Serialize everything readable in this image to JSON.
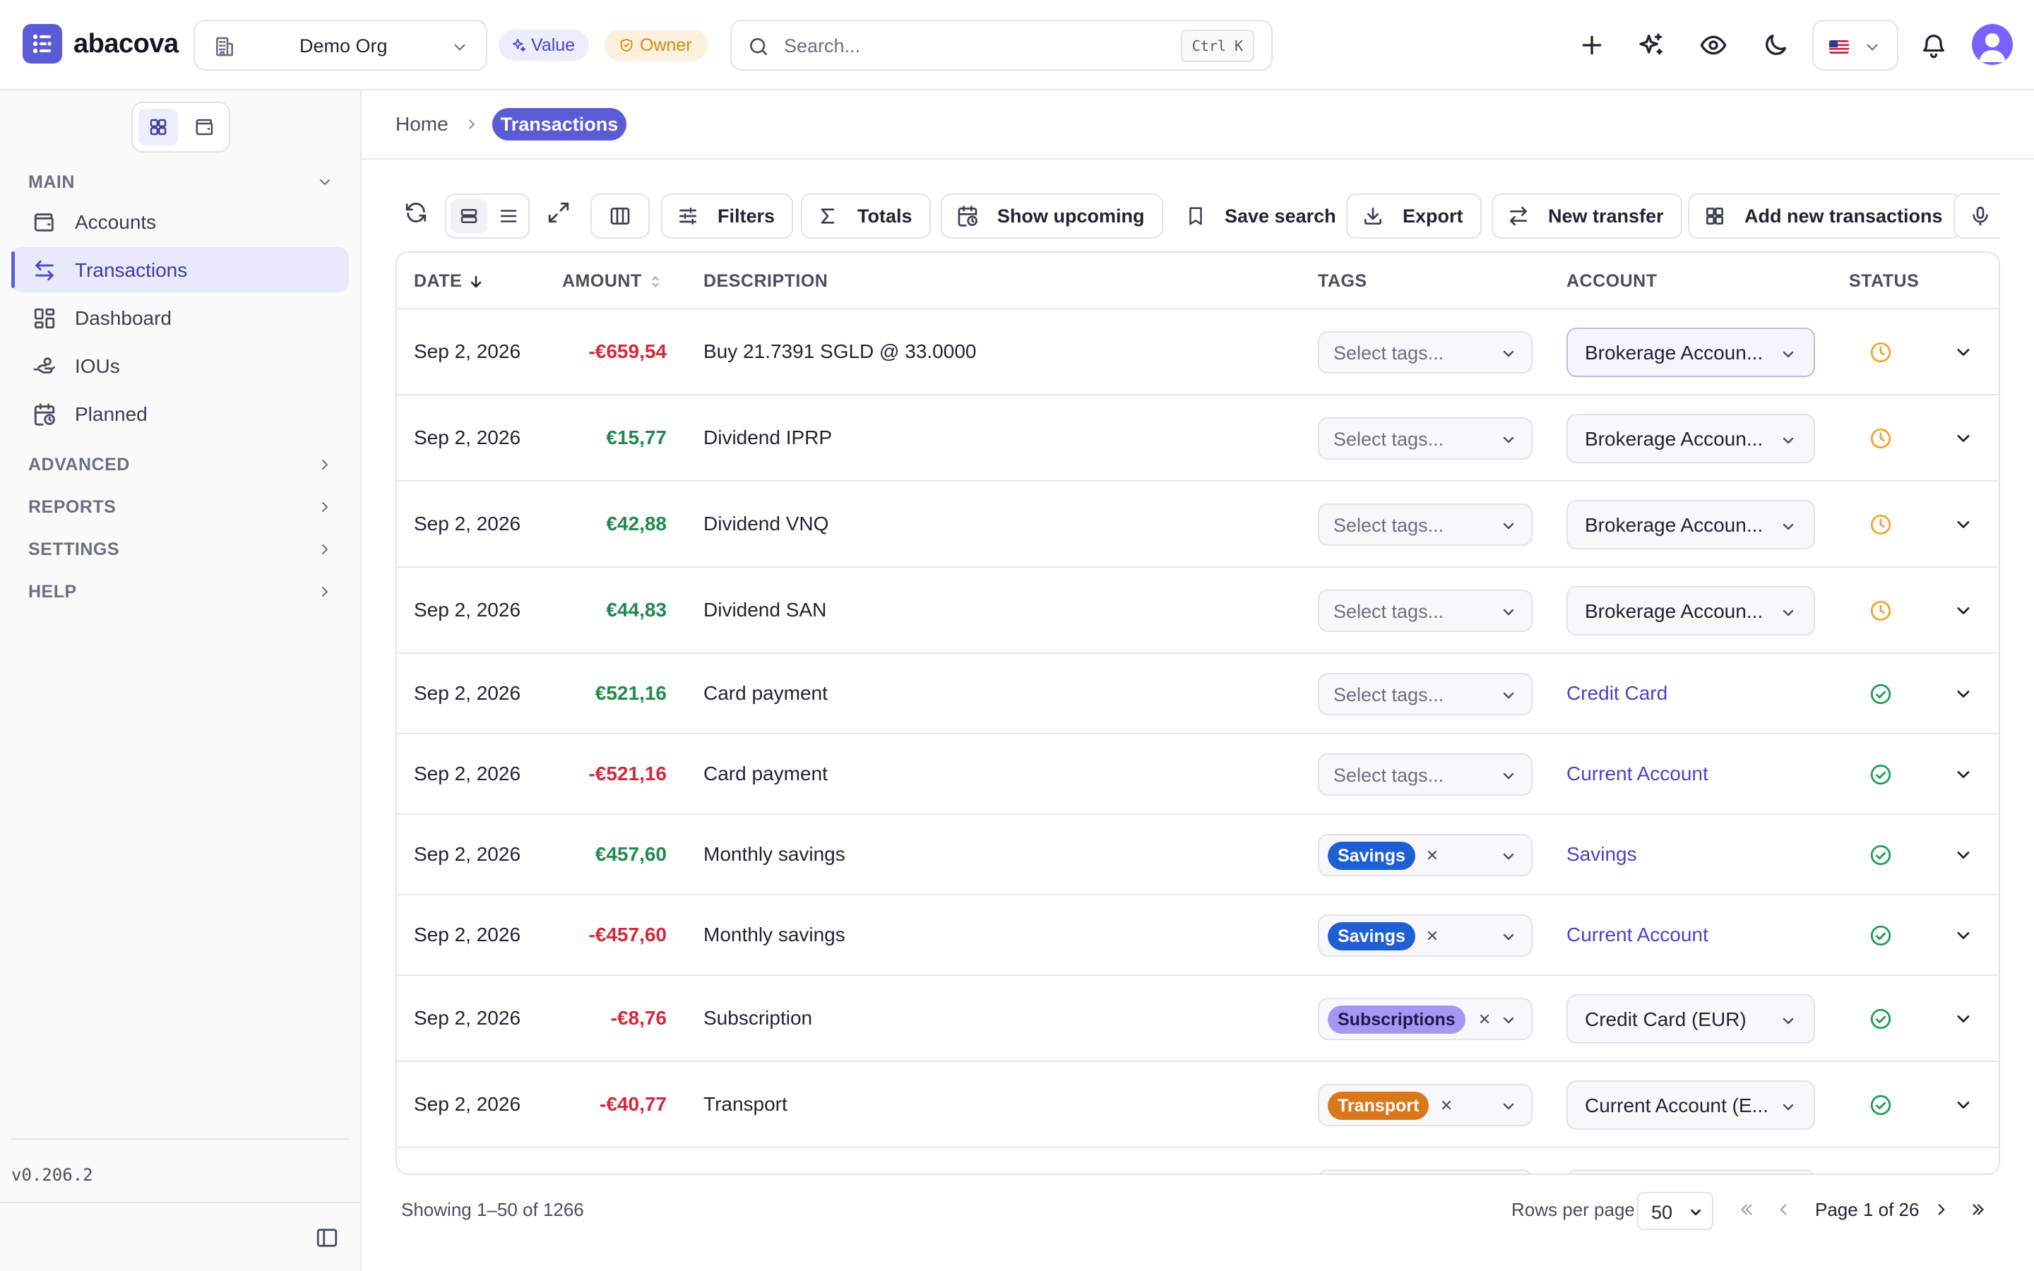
{
  "app": {
    "name": "abacova",
    "org": "Demo Org",
    "role_value": "Value",
    "role_owner": "Owner",
    "search_placeholder": "Search...",
    "search_shortcut": "Ctrl K",
    "version": "v0.206.2"
  },
  "colors": {
    "brand": "#5b5bd6",
    "negative": "#d12a3b",
    "positive": "#1f8a4c",
    "pending": "#f2a531",
    "confirmed": "#1f9e5a",
    "tag_savings": "#1f5fd6",
    "tag_subscriptions": "#a896f5",
    "tag_transport": "#d9781a"
  },
  "topbar_icons": [
    "plus-icon",
    "sparkles-icon",
    "eye-icon",
    "moon-icon",
    "us-flag-icon",
    "bell-icon",
    "avatar"
  ],
  "sidebar": {
    "main_label": "MAIN",
    "items": [
      {
        "label": "Accounts",
        "icon": "wallet-icon"
      },
      {
        "label": "Transactions",
        "icon": "transfer-arrows-icon"
      },
      {
        "label": "Dashboard",
        "icon": "dashboard-grid-icon"
      },
      {
        "label": "IOUs",
        "icon": "hand-coins-icon"
      },
      {
        "label": "Planned",
        "icon": "calendar-clock-icon"
      }
    ],
    "sections": [
      "ADVANCED",
      "REPORTS",
      "SETTINGS",
      "HELP"
    ]
  },
  "breadcrumb": {
    "home": "Home",
    "current": "Transactions"
  },
  "toolbar": {
    "filters": "Filters",
    "totals": "Totals",
    "show_upcoming": "Show upcoming",
    "save_search": "Save search",
    "export": "Export",
    "new_transfer": "New transfer",
    "add_new": "Add new transactions"
  },
  "table": {
    "headers": {
      "date": "DATE",
      "amount": "AMOUNT",
      "description": "DESCRIPTION",
      "tags": "TAGS",
      "account": "ACCOUNT",
      "status": "STATUS"
    },
    "tag_placeholder": "Select tags...",
    "rows": [
      {
        "date": "Sep 2, 2026",
        "amount": "-€659,54",
        "sign": "neg",
        "description": "Buy 21.7391 SGLD @ 33.0000",
        "tag": "",
        "account": "Brokerage Accoun...",
        "account_kind": "select",
        "status": "pending"
      },
      {
        "date": "Sep 2, 2026",
        "amount": "€15,77",
        "sign": "pos",
        "description": "Dividend IPRP",
        "tag": "",
        "account": "Brokerage Accoun...",
        "account_kind": "select",
        "status": "pending"
      },
      {
        "date": "Sep 2, 2026",
        "amount": "€42,88",
        "sign": "pos",
        "description": "Dividend VNQ",
        "tag": "",
        "account": "Brokerage Accoun...",
        "account_kind": "select",
        "status": "pending"
      },
      {
        "date": "Sep 2, 2026",
        "amount": "€44,83",
        "sign": "pos",
        "description": "Dividend SAN",
        "tag": "",
        "account": "Brokerage Accoun...",
        "account_kind": "select",
        "status": "pending"
      },
      {
        "date": "Sep 2, 2026",
        "amount": "€521,16",
        "sign": "pos",
        "description": "Card payment",
        "tag": "",
        "account": "Credit Card",
        "account_kind": "link",
        "status": "confirmed"
      },
      {
        "date": "Sep 2, 2026",
        "amount": "-€521,16",
        "sign": "neg",
        "description": "Card payment",
        "tag": "",
        "account": "Current Account",
        "account_kind": "link",
        "status": "confirmed"
      },
      {
        "date": "Sep 2, 2026",
        "amount": "€457,60",
        "sign": "pos",
        "description": "Monthly savings",
        "tag": "Savings",
        "account": "Savings",
        "account_kind": "link",
        "status": "confirmed"
      },
      {
        "date": "Sep 2, 2026",
        "amount": "-€457,60",
        "sign": "neg",
        "description": "Monthly savings",
        "tag": "Savings",
        "account": "Current Account",
        "account_kind": "link",
        "status": "confirmed"
      },
      {
        "date": "Sep 2, 2026",
        "amount": "-€8,76",
        "sign": "neg",
        "description": "Subscription",
        "tag": "Subscriptions",
        "account": "Credit Card (EUR)",
        "account_kind": "select",
        "status": "confirmed"
      },
      {
        "date": "Sep 2, 2026",
        "amount": "-€40,77",
        "sign": "neg",
        "description": "Transport",
        "tag": "Transport",
        "account": "Current Account (E...",
        "account_kind": "select",
        "status": "confirmed"
      }
    ]
  },
  "footer": {
    "showing": "Showing 1–50 of 1266",
    "rows_per_page_label": "Rows per page",
    "rows_per_page": "50",
    "page_text": "Page 1 of 26"
  }
}
